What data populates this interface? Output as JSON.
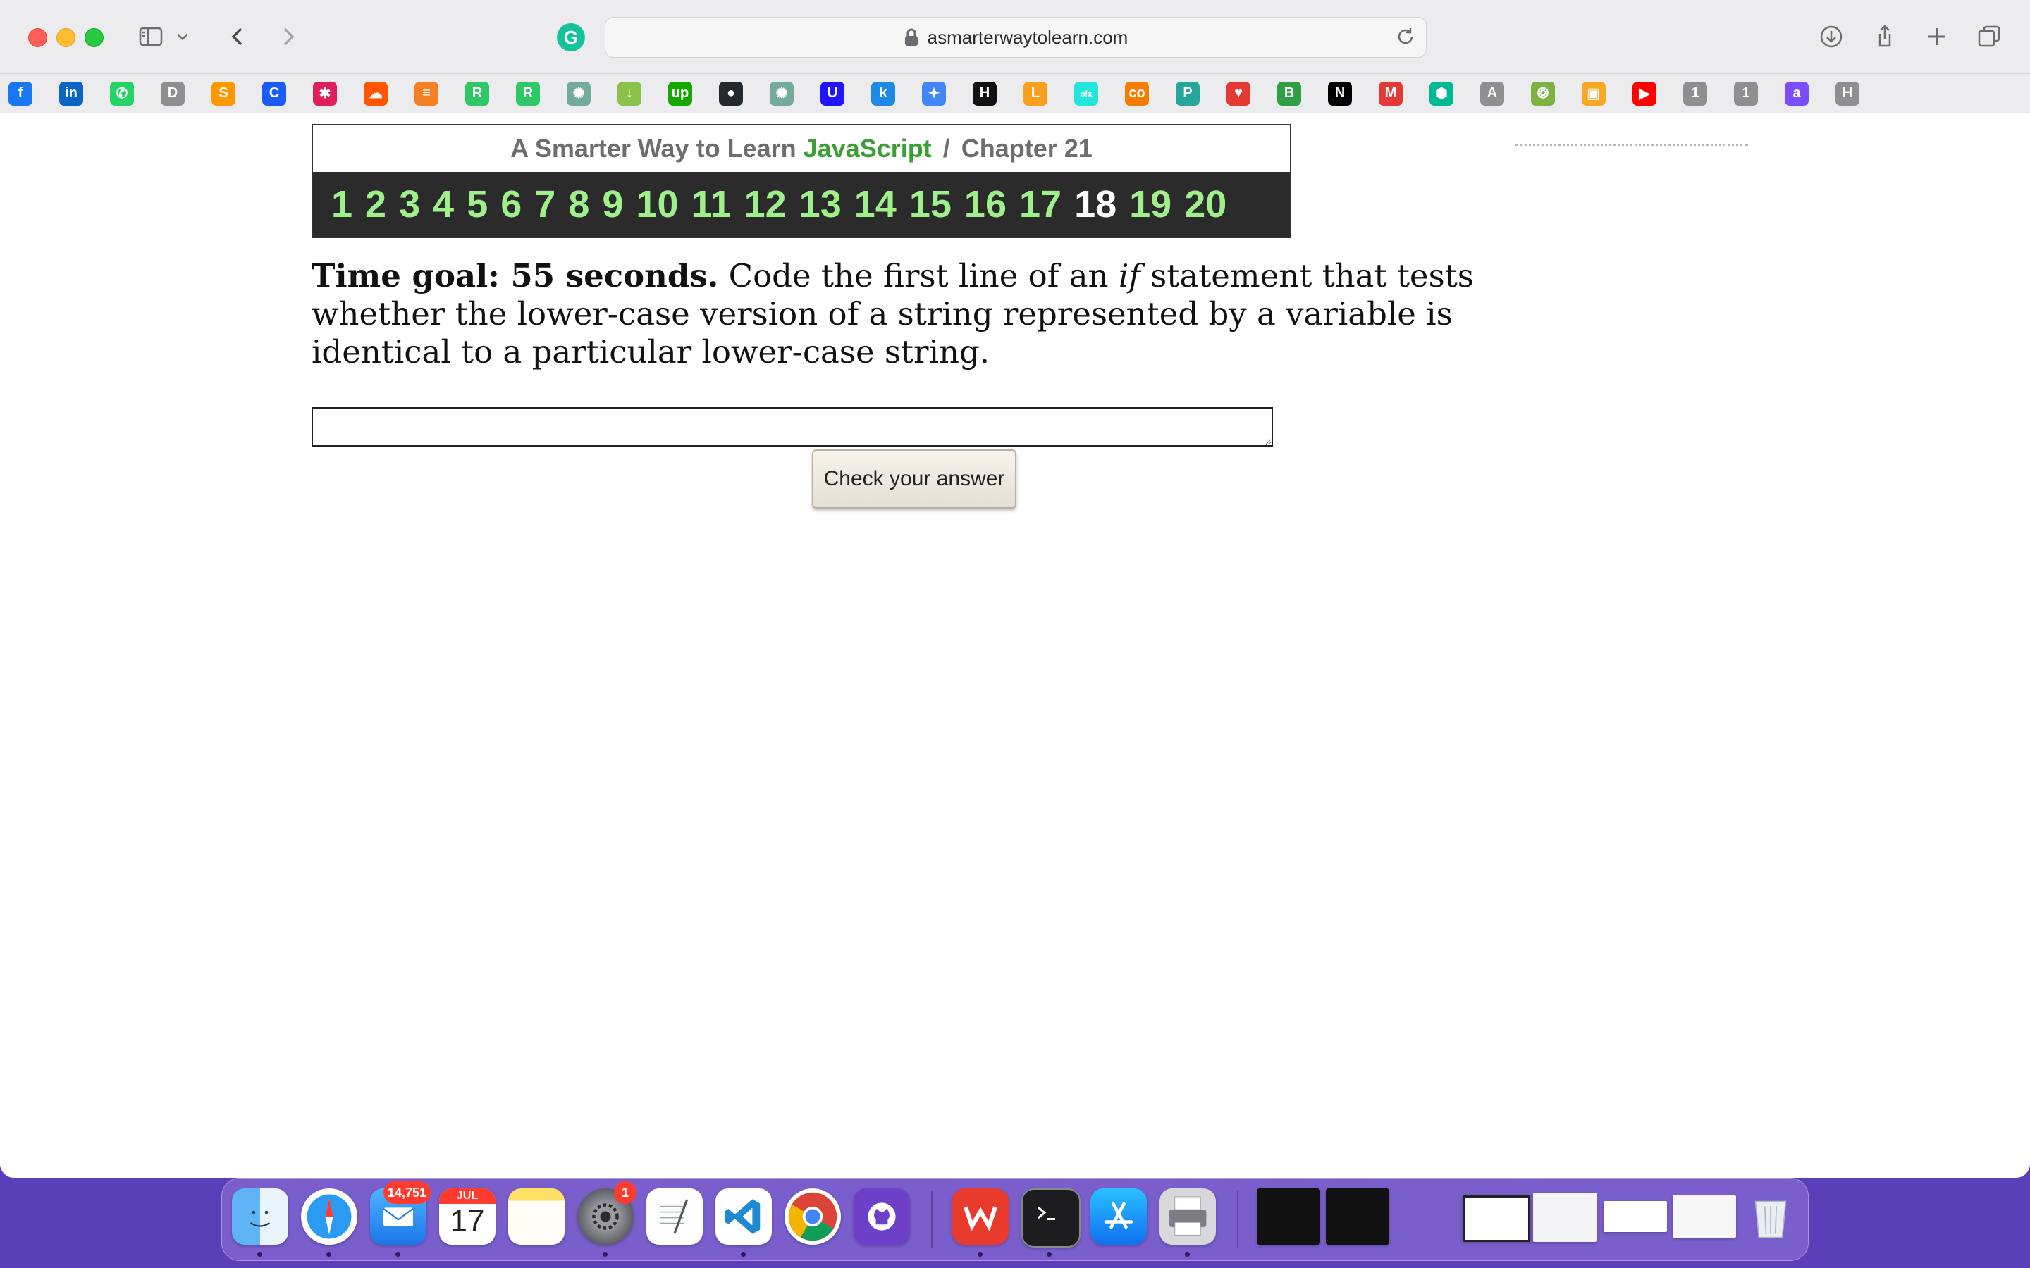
{
  "browser": {
    "url": "asmarterwaytolearn.com",
    "grammarly_letter": "G"
  },
  "favorites": [
    {
      "icon": "facebook-icon",
      "glyph": "f",
      "color": "#1877f2"
    },
    {
      "icon": "linkedin-icon",
      "glyph": "in",
      "color": "#0a66c2"
    },
    {
      "icon": "whatsapp-icon",
      "glyph": "✆",
      "color": "#25d366"
    },
    {
      "icon": "d-icon",
      "glyph": "D",
      "color": "#8e8e93"
    },
    {
      "icon": "sublime-icon",
      "glyph": "S",
      "color": "#ff9800"
    },
    {
      "icon": "c-icon",
      "glyph": "C",
      "color": "#1a5cf5"
    },
    {
      "icon": "slack-icon",
      "glyph": "✱",
      "color": "#e01e5a"
    },
    {
      "icon": "soundcloud-icon",
      "glyph": "☁",
      "color": "#ff5500"
    },
    {
      "icon": "stackoverflow-icon",
      "glyph": "≡",
      "color": "#f48024"
    },
    {
      "icon": "hackerrank-icon-1",
      "glyph": "R",
      "color": "#2ec866"
    },
    {
      "icon": "hackerrank-icon-2",
      "glyph": "R",
      "color": "#2ec866"
    },
    {
      "icon": "chatgpt-icon-1",
      "glyph": "✺",
      "color": "#74aa9c"
    },
    {
      "icon": "download-icon",
      "glyph": "↓",
      "color": "#8bc34a"
    },
    {
      "icon": "upwork-icon",
      "glyph": "up",
      "color": "#14a800"
    },
    {
      "icon": "github-icon",
      "glyph": "●",
      "color": "#24292e"
    },
    {
      "icon": "chatgpt-icon-2",
      "glyph": "✺",
      "color": "#74aa9c"
    },
    {
      "icon": "udacity-icon",
      "glyph": "U",
      "color": "#2015ff"
    },
    {
      "icon": "k-icon",
      "glyph": "k",
      "color": "#1e88e5"
    },
    {
      "icon": "gemini-icon",
      "glyph": "✦",
      "color": "#4285f4"
    },
    {
      "icon": "hh-icon",
      "glyph": "H",
      "color": "#111111"
    },
    {
      "icon": "leetcode-icon",
      "glyph": "L",
      "color": "#f89f1b"
    },
    {
      "icon": "olx-icon",
      "glyph": "olx",
      "color": "#23e5db"
    },
    {
      "icon": "coursera-icon",
      "glyph": "co",
      "color": "#f57c00"
    },
    {
      "icon": "p-icon",
      "glyph": "P",
      "color": "#26a69a"
    },
    {
      "icon": "heart-icon",
      "glyph": "♥",
      "color": "#e53935"
    },
    {
      "icon": "green-app-icon",
      "glyph": "B",
      "color": "#2ea043"
    },
    {
      "icon": "notion-icon",
      "glyph": "N",
      "color": "#000000"
    },
    {
      "icon": "m-icon",
      "glyph": "M",
      "color": "#e53935"
    },
    {
      "icon": "hex-icon",
      "glyph": "⬢",
      "color": "#00b894"
    },
    {
      "icon": "a-gray-icon",
      "glyph": "A",
      "color": "#8e8e93"
    },
    {
      "icon": "emblem-icon",
      "glyph": "❂",
      "color": "#7cb342"
    },
    {
      "icon": "classroom-icon",
      "glyph": "▣",
      "color": "#f9a825"
    },
    {
      "icon": "youtube-icon",
      "glyph": "▶",
      "color": "#ff0000"
    },
    {
      "icon": "one-icon-1",
      "glyph": "1",
      "color": "#8e8e93"
    },
    {
      "icon": "one-icon-2",
      "glyph": "1",
      "color": "#8e8e93"
    },
    {
      "icon": "a-purple-icon",
      "glyph": "a",
      "color": "#7c4dff"
    },
    {
      "icon": "h-icon",
      "glyph": "H",
      "color": "#8e8e93"
    }
  ],
  "page": {
    "header_prefix": "A Smarter Way to Learn",
    "header_brand": "JavaScript",
    "header_separator": "/",
    "header_chapter": "Chapter 21",
    "chapter_numbers": [
      "1",
      "2",
      "3",
      "4",
      "5",
      "6",
      "7",
      "8",
      "9",
      "10",
      "11",
      "12",
      "13",
      "14",
      "15",
      "16",
      "17",
      "18",
      "19",
      "20"
    ],
    "current_number": "18",
    "question": {
      "goal": "Time goal: 55 seconds.",
      "text_before_if": " Code the first line of an ",
      "if_word": "if",
      "text_after_if": " statement that tests whether the lower-case version of a string represented by a variable is identical to a particular lower-case string."
    },
    "answer_value": "",
    "check_button_label": "Check your answer"
  },
  "dock": {
    "mail_badge": "14,751",
    "calendar_month": "JUL",
    "calendar_day": "17",
    "settings_badge": "1",
    "items": [
      "finder-icon",
      "safari-icon",
      "mail-icon",
      "calendar-icon",
      "notes-icon",
      "system-settings-icon",
      "textedit-icon",
      "vscode-icon",
      "chrome-icon",
      "github-desktop-icon",
      "wps-icon",
      "terminal-icon",
      "app-store-icon",
      "printer-icon"
    ]
  }
}
